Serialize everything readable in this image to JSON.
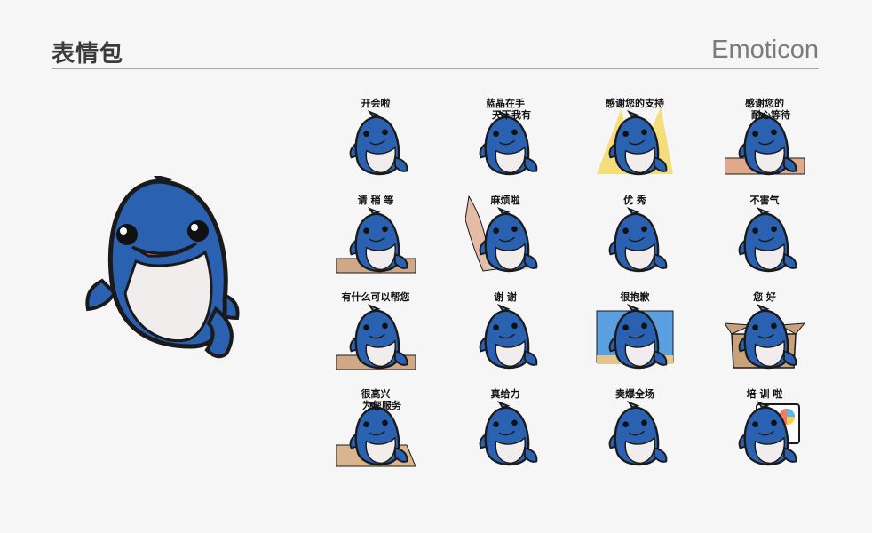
{
  "header": {
    "title_cn": "表情包",
    "title_en": "Emoticon"
  },
  "colors": {
    "whale_blue": "#2a61b0",
    "belly": "#f2eded",
    "outline": "#1a1a1a",
    "rule": "#a5a5a5"
  },
  "stickers": [
    {
      "caption": "开会啦"
    },
    {
      "caption": "蓝晶在手",
      "caption2": "天下我有"
    },
    {
      "caption": "感谢您的支持"
    },
    {
      "caption": "感谢您的",
      "caption2": "耐心等待"
    },
    {
      "caption": "请 稍 等"
    },
    {
      "caption": "麻烦啦"
    },
    {
      "caption": "优 秀"
    },
    {
      "caption": "不害气",
      "icon": "sign-board"
    },
    {
      "caption": "有什么可以帮您"
    },
    {
      "caption": "谢 谢"
    },
    {
      "caption": "很抱歉"
    },
    {
      "caption": "您 好"
    },
    {
      "caption": "很高兴",
      "caption2": "为您服务"
    },
    {
      "caption": "真给力"
    },
    {
      "caption": "卖爆全场"
    },
    {
      "caption": "培 训 啦"
    }
  ]
}
